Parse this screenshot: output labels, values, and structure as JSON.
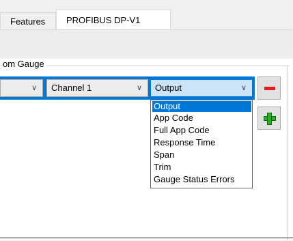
{
  "tabs": [
    {
      "label": "Features",
      "active": false
    },
    {
      "label": "PROFIBUS DP-V1",
      "active": true
    }
  ],
  "group": {
    "label": "om Gauge"
  },
  "row": {
    "combo_first": {
      "value": ""
    },
    "combo_channel": {
      "value": "Channel 1"
    },
    "combo_output": {
      "value": "Output"
    }
  },
  "dropdown": {
    "options": [
      "Output",
      "App Code",
      "Full App Code",
      "Response Time",
      "Span",
      "Trim",
      "Gauge Status Errors"
    ],
    "selected": "Output"
  },
  "buttons": {
    "remove_icon": "minus-icon",
    "add_icon": "plus-icon"
  },
  "colors": {
    "selection": "#0078d7",
    "remove": "#e51c23",
    "add": "#2eaa2e"
  }
}
